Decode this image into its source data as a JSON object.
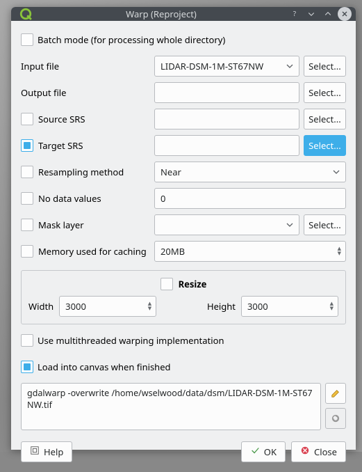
{
  "title": "Warp (Reproject)",
  "batch_mode": {
    "label": "Batch mode (for processing whole directory)",
    "checked": false
  },
  "input_file": {
    "label": "Input file",
    "value": "LIDAR-DSM-1M-ST67NW",
    "select": "Select..."
  },
  "output_file": {
    "label": "Output file",
    "value": "",
    "select": "Select..."
  },
  "source_srs": {
    "label": "Source SRS",
    "checked": false,
    "value": "",
    "select": "Select..."
  },
  "target_srs": {
    "label": "Target SRS",
    "checked": true,
    "value": "",
    "select": "Select..."
  },
  "resampling": {
    "label": "Resampling method",
    "checked": false,
    "value": "Near"
  },
  "nodata": {
    "label": "No data values",
    "checked": false,
    "value": "0"
  },
  "mask": {
    "label": "Mask layer",
    "checked": false,
    "value": "",
    "select": "Select..."
  },
  "memory": {
    "label": "Memory used for caching",
    "checked": false,
    "value": "20MB"
  },
  "resize": {
    "legend": "Resize",
    "checked": false,
    "width_label": "Width",
    "width": "3000",
    "height_label": "Height",
    "height": "3000"
  },
  "multithread": {
    "label": "Use multithreaded warping implementation",
    "checked": false
  },
  "load_canvas": {
    "label": "Load into canvas when finished",
    "checked": true
  },
  "command": "gdalwarp -overwrite /home/wselwood/data/dsm/LIDAR-DSM-1M-ST67NW.tif",
  "buttons": {
    "help": "Help",
    "ok": "OK",
    "close": "Close"
  }
}
